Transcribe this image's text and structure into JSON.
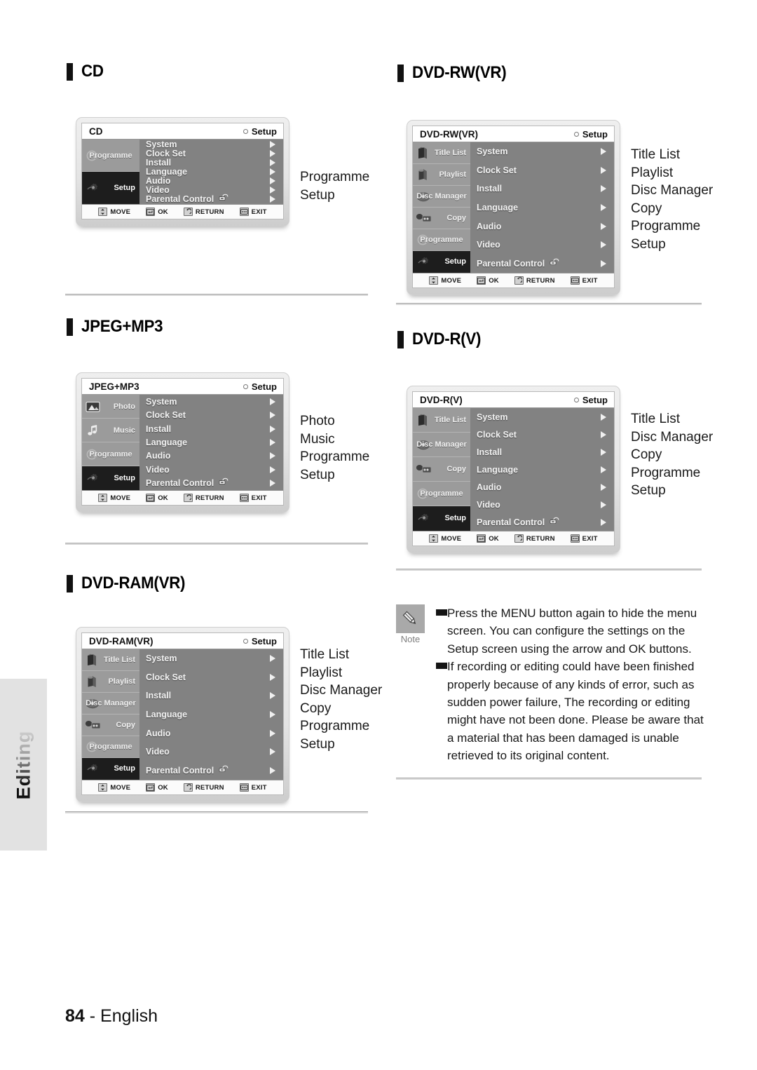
{
  "page": {
    "number": "84",
    "separator": "-",
    "language": "English",
    "side_tab": "Editing"
  },
  "menu_items": [
    "System",
    "Clock Set",
    "Install",
    "Language",
    "Audio",
    "Video",
    "Parental Control"
  ],
  "footer_keys": [
    {
      "icon": "dpad-icon",
      "label": "MOVE"
    },
    {
      "icon": "enter-icon",
      "label": "OK"
    },
    {
      "icon": "return-icon",
      "label": "RETURN"
    },
    {
      "icon": "exit-icon",
      "label": "EXIT"
    }
  ],
  "setup_tag": "Setup",
  "sections": [
    {
      "id": "cd",
      "heading": "CD",
      "osd_title": "CD",
      "sidebar": [
        {
          "label": "Programme",
          "icon": "programme-icon",
          "active": false
        },
        {
          "label": "Setup",
          "icon": "gear-icon",
          "active": true
        }
      ],
      "captions": [
        "Programme",
        "Setup"
      ]
    },
    {
      "id": "dvd-rw-vr",
      "heading": "DVD-RW(VR)",
      "osd_title": "DVD-RW(VR)",
      "sidebar": [
        {
          "label": "Title List",
          "icon": "disc-title-icon",
          "active": false
        },
        {
          "label": "Playlist",
          "icon": "disc-playlist-icon",
          "active": false
        },
        {
          "label": "Disc Manager",
          "icon": "disc-manager-icon",
          "active": false
        },
        {
          "label": "Copy",
          "icon": "copy-icon",
          "active": false
        },
        {
          "label": "Programme",
          "icon": "programme-icon",
          "active": false
        },
        {
          "label": "Setup",
          "icon": "gear-icon",
          "active": true
        }
      ],
      "captions": [
        "Title List",
        "Playlist",
        "Disc Manager",
        "Copy",
        "Programme",
        "Setup"
      ]
    },
    {
      "id": "jpeg-mp3",
      "heading": "JPEG+MP3",
      "osd_title": "JPEG+MP3",
      "sidebar": [
        {
          "label": "Photo",
          "icon": "photo-icon",
          "active": false
        },
        {
          "label": "Music",
          "icon": "music-note-icon",
          "active": false
        },
        {
          "label": "Programme",
          "icon": "programme-icon",
          "active": false
        },
        {
          "label": "Setup",
          "icon": "gear-icon",
          "active": true
        }
      ],
      "captions": [
        "Photo",
        "Music",
        "Programme",
        "Setup"
      ]
    },
    {
      "id": "dvd-r-v",
      "heading": "DVD-R(V)",
      "osd_title": "DVD-R(V)",
      "sidebar": [
        {
          "label": "Title List",
          "icon": "disc-title-icon",
          "active": false
        },
        {
          "label": "Disc Manager",
          "icon": "disc-manager-icon",
          "active": false
        },
        {
          "label": "Copy",
          "icon": "copy-icon",
          "active": false
        },
        {
          "label": "Programme",
          "icon": "programme-icon",
          "active": false
        },
        {
          "label": "Setup",
          "icon": "gear-icon",
          "active": true
        }
      ],
      "captions": [
        "Title List",
        "Disc Manager",
        "Copy",
        "Programme",
        "Setup"
      ]
    },
    {
      "id": "dvd-ram-vr",
      "heading": "DVD-RAM(VR)",
      "osd_title": "DVD-RAM(VR)",
      "sidebar": [
        {
          "label": "Title List",
          "icon": "disc-title-icon",
          "active": false
        },
        {
          "label": "Playlist",
          "icon": "disc-playlist-icon",
          "active": false
        },
        {
          "label": "Disc Manager",
          "icon": "disc-manager-icon",
          "active": false
        },
        {
          "label": "Copy",
          "icon": "copy-icon",
          "active": false
        },
        {
          "label": "Programme",
          "icon": "programme-icon",
          "active": false
        },
        {
          "label": "Setup",
          "icon": "gear-icon",
          "active": true
        }
      ],
      "captions": [
        "Title List",
        "Playlist",
        "Disc Manager",
        "Copy",
        "Programme",
        "Setup"
      ]
    }
  ],
  "note": {
    "icon": "pencil-icon",
    "caption": "Note",
    "items": [
      "Press the MENU button again to hide the menu screen. You can configure the settings on the Setup screen using the arrow and OK buttons.",
      "If recording or editing could have been finished properly because of any kinds of error, such as sudden power failure, The recording or editing might have not been done. Please be aware that a material that has been damaged is unable retrieved to its original content."
    ]
  }
}
